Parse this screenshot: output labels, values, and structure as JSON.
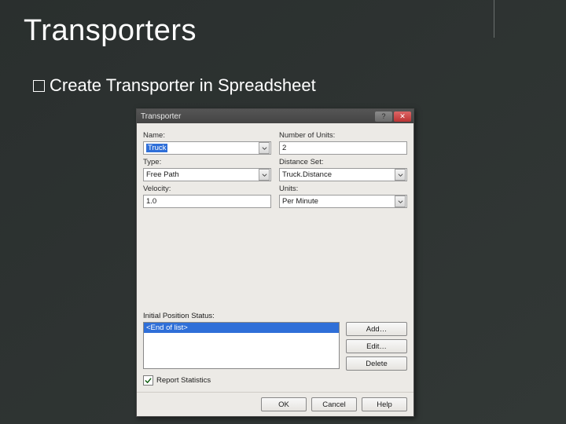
{
  "slide": {
    "title": "Transporters",
    "bullet": "Create Transporter in Spreadsheet"
  },
  "dialog": {
    "title": "Transporter",
    "labels": {
      "name": "Name:",
      "number_of_units": "Number of Units:",
      "type": "Type:",
      "distance_set": "Distance Set:",
      "velocity": "Velocity:",
      "units": "Units:",
      "initial_position": "Initial Position Status:",
      "report_stats": "Report Statistics"
    },
    "values": {
      "name": "Truck",
      "number_of_units": "2",
      "type": "Free Path",
      "distance_set": "Truck.Distance",
      "velocity": "1.0",
      "units": "Per Minute"
    },
    "list": {
      "selected": "<End of list>"
    },
    "buttons": {
      "add": "Add…",
      "edit": "Edit…",
      "delete": "Delete",
      "ok": "OK",
      "cancel": "Cancel",
      "help": "Help"
    },
    "report_checked": true
  }
}
